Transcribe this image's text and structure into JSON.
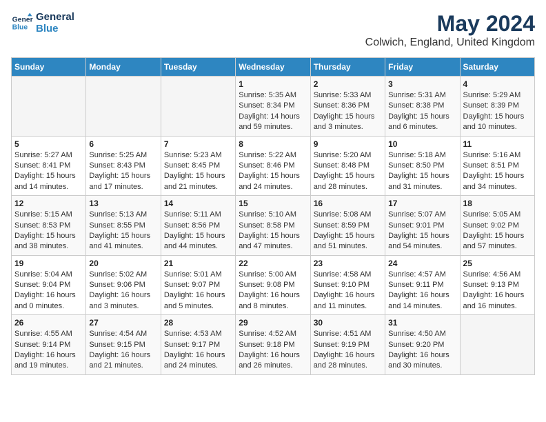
{
  "logo": {
    "line1": "General",
    "line2": "Blue"
  },
  "title": "May 2024",
  "location": "Colwich, England, United Kingdom",
  "days_of_week": [
    "Sunday",
    "Monday",
    "Tuesday",
    "Wednesday",
    "Thursday",
    "Friday",
    "Saturday"
  ],
  "weeks": [
    [
      {
        "day": "",
        "sunrise": "",
        "sunset": "",
        "daylight": ""
      },
      {
        "day": "",
        "sunrise": "",
        "sunset": "",
        "daylight": ""
      },
      {
        "day": "",
        "sunrise": "",
        "sunset": "",
        "daylight": ""
      },
      {
        "day": "1",
        "sunrise": "Sunrise: 5:35 AM",
        "sunset": "Sunset: 8:34 PM",
        "daylight": "Daylight: 14 hours and 59 minutes."
      },
      {
        "day": "2",
        "sunrise": "Sunrise: 5:33 AM",
        "sunset": "Sunset: 8:36 PM",
        "daylight": "Daylight: 15 hours and 3 minutes."
      },
      {
        "day": "3",
        "sunrise": "Sunrise: 5:31 AM",
        "sunset": "Sunset: 8:38 PM",
        "daylight": "Daylight: 15 hours and 6 minutes."
      },
      {
        "day": "4",
        "sunrise": "Sunrise: 5:29 AM",
        "sunset": "Sunset: 8:39 PM",
        "daylight": "Daylight: 15 hours and 10 minutes."
      }
    ],
    [
      {
        "day": "5",
        "sunrise": "Sunrise: 5:27 AM",
        "sunset": "Sunset: 8:41 PM",
        "daylight": "Daylight: 15 hours and 14 minutes."
      },
      {
        "day": "6",
        "sunrise": "Sunrise: 5:25 AM",
        "sunset": "Sunset: 8:43 PM",
        "daylight": "Daylight: 15 hours and 17 minutes."
      },
      {
        "day": "7",
        "sunrise": "Sunrise: 5:23 AM",
        "sunset": "Sunset: 8:45 PM",
        "daylight": "Daylight: 15 hours and 21 minutes."
      },
      {
        "day": "8",
        "sunrise": "Sunrise: 5:22 AM",
        "sunset": "Sunset: 8:46 PM",
        "daylight": "Daylight: 15 hours and 24 minutes."
      },
      {
        "day": "9",
        "sunrise": "Sunrise: 5:20 AM",
        "sunset": "Sunset: 8:48 PM",
        "daylight": "Daylight: 15 hours and 28 minutes."
      },
      {
        "day": "10",
        "sunrise": "Sunrise: 5:18 AM",
        "sunset": "Sunset: 8:50 PM",
        "daylight": "Daylight: 15 hours and 31 minutes."
      },
      {
        "day": "11",
        "sunrise": "Sunrise: 5:16 AM",
        "sunset": "Sunset: 8:51 PM",
        "daylight": "Daylight: 15 hours and 34 minutes."
      }
    ],
    [
      {
        "day": "12",
        "sunrise": "Sunrise: 5:15 AM",
        "sunset": "Sunset: 8:53 PM",
        "daylight": "Daylight: 15 hours and 38 minutes."
      },
      {
        "day": "13",
        "sunrise": "Sunrise: 5:13 AM",
        "sunset": "Sunset: 8:55 PM",
        "daylight": "Daylight: 15 hours and 41 minutes."
      },
      {
        "day": "14",
        "sunrise": "Sunrise: 5:11 AM",
        "sunset": "Sunset: 8:56 PM",
        "daylight": "Daylight: 15 hours and 44 minutes."
      },
      {
        "day": "15",
        "sunrise": "Sunrise: 5:10 AM",
        "sunset": "Sunset: 8:58 PM",
        "daylight": "Daylight: 15 hours and 47 minutes."
      },
      {
        "day": "16",
        "sunrise": "Sunrise: 5:08 AM",
        "sunset": "Sunset: 8:59 PM",
        "daylight": "Daylight: 15 hours and 51 minutes."
      },
      {
        "day": "17",
        "sunrise": "Sunrise: 5:07 AM",
        "sunset": "Sunset: 9:01 PM",
        "daylight": "Daylight: 15 hours and 54 minutes."
      },
      {
        "day": "18",
        "sunrise": "Sunrise: 5:05 AM",
        "sunset": "Sunset: 9:02 PM",
        "daylight": "Daylight: 15 hours and 57 minutes."
      }
    ],
    [
      {
        "day": "19",
        "sunrise": "Sunrise: 5:04 AM",
        "sunset": "Sunset: 9:04 PM",
        "daylight": "Daylight: 16 hours and 0 minutes."
      },
      {
        "day": "20",
        "sunrise": "Sunrise: 5:02 AM",
        "sunset": "Sunset: 9:06 PM",
        "daylight": "Daylight: 16 hours and 3 minutes."
      },
      {
        "day": "21",
        "sunrise": "Sunrise: 5:01 AM",
        "sunset": "Sunset: 9:07 PM",
        "daylight": "Daylight: 16 hours and 5 minutes."
      },
      {
        "day": "22",
        "sunrise": "Sunrise: 5:00 AM",
        "sunset": "Sunset: 9:08 PM",
        "daylight": "Daylight: 16 hours and 8 minutes."
      },
      {
        "day": "23",
        "sunrise": "Sunrise: 4:58 AM",
        "sunset": "Sunset: 9:10 PM",
        "daylight": "Daylight: 16 hours and 11 minutes."
      },
      {
        "day": "24",
        "sunrise": "Sunrise: 4:57 AM",
        "sunset": "Sunset: 9:11 PM",
        "daylight": "Daylight: 16 hours and 14 minutes."
      },
      {
        "day": "25",
        "sunrise": "Sunrise: 4:56 AM",
        "sunset": "Sunset: 9:13 PM",
        "daylight": "Daylight: 16 hours and 16 minutes."
      }
    ],
    [
      {
        "day": "26",
        "sunrise": "Sunrise: 4:55 AM",
        "sunset": "Sunset: 9:14 PM",
        "daylight": "Daylight: 16 hours and 19 minutes."
      },
      {
        "day": "27",
        "sunrise": "Sunrise: 4:54 AM",
        "sunset": "Sunset: 9:15 PM",
        "daylight": "Daylight: 16 hours and 21 minutes."
      },
      {
        "day": "28",
        "sunrise": "Sunrise: 4:53 AM",
        "sunset": "Sunset: 9:17 PM",
        "daylight": "Daylight: 16 hours and 24 minutes."
      },
      {
        "day": "29",
        "sunrise": "Sunrise: 4:52 AM",
        "sunset": "Sunset: 9:18 PM",
        "daylight": "Daylight: 16 hours and 26 minutes."
      },
      {
        "day": "30",
        "sunrise": "Sunrise: 4:51 AM",
        "sunset": "Sunset: 9:19 PM",
        "daylight": "Daylight: 16 hours and 28 minutes."
      },
      {
        "day": "31",
        "sunrise": "Sunrise: 4:50 AM",
        "sunset": "Sunset: 9:20 PM",
        "daylight": "Daylight: 16 hours and 30 minutes."
      },
      {
        "day": "",
        "sunrise": "",
        "sunset": "",
        "daylight": ""
      }
    ]
  ]
}
